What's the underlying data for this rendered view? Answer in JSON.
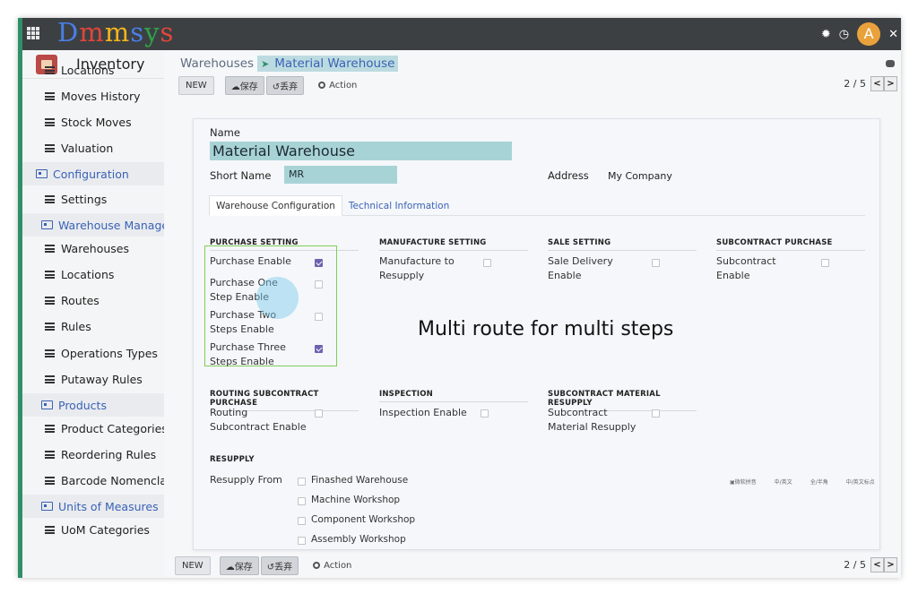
{
  "brand": {
    "letters": [
      {
        "ch": "D",
        "color": "#4a7fe6"
      },
      {
        "ch": "m",
        "color": "#e0463b"
      },
      {
        "ch": "m",
        "color": "#f2b51c"
      },
      {
        "ch": "s",
        "color": "#4a7fe6"
      },
      {
        "ch": "y",
        "color": "#2fa24a"
      },
      {
        "ch": "s",
        "color": "#e0463b"
      }
    ]
  },
  "topbar": {
    "avatar_letter": "A",
    "icons": [
      "bug-icon",
      "clock-icon",
      "expand-icon"
    ]
  },
  "sidebar": {
    "title": "Inventory",
    "entries": [
      {
        "kind": "item",
        "label": "Locations"
      },
      {
        "kind": "item",
        "label": "Moves History"
      },
      {
        "kind": "item",
        "label": "Stock Moves"
      },
      {
        "kind": "item",
        "label": "Valuation"
      },
      {
        "kind": "cat",
        "label": "Configuration",
        "indent": false
      },
      {
        "kind": "item",
        "label": "Settings"
      },
      {
        "kind": "cat",
        "label": "Warehouse Managen",
        "indent": true
      },
      {
        "kind": "item",
        "label": "Warehouses"
      },
      {
        "kind": "item",
        "label": "Locations"
      },
      {
        "kind": "item",
        "label": "Routes"
      },
      {
        "kind": "item",
        "label": "Rules"
      },
      {
        "kind": "item",
        "label": "Operations Types"
      },
      {
        "kind": "item",
        "label": "Putaway Rules"
      },
      {
        "kind": "cat",
        "label": "Products",
        "indent": true
      },
      {
        "kind": "item",
        "label": "Product Categories"
      },
      {
        "kind": "item",
        "label": "Reordering Rules"
      },
      {
        "kind": "item",
        "label": "Barcode Nomenclatu"
      },
      {
        "kind": "cat",
        "label": "Units of Measures",
        "indent": true
      },
      {
        "kind": "item",
        "label": "UoM Categories"
      }
    ]
  },
  "breadcrumb": {
    "parent": "Warehouses",
    "current": "Material Warehouse"
  },
  "toolbar": {
    "new_label": "NEW",
    "save_label": "☁保存",
    "discard_label": "↺丢弃",
    "action_label": "Action"
  },
  "pager": {
    "count": "2 / 5",
    "prev": "<",
    "next": ">"
  },
  "form": {
    "name_label": "Name",
    "name_value": "Material Warehouse",
    "short_name_label": "Short Name",
    "short_name_value": "MR",
    "address_label": "Address",
    "address_value": "My Company",
    "tabs": [
      "Warehouse Configuration",
      "Technical Information"
    ],
    "sections": {
      "purchase": {
        "title": "PURCHASE SETTING",
        "options": [
          {
            "label": "Purchase Enable",
            "checked": true
          },
          {
            "label": "Purchase One Step Enable",
            "checked": false
          },
          {
            "label": "Purchase Two Steps Enable",
            "checked": false
          },
          {
            "label": "Purchase Three Steps Enable",
            "checked": true
          }
        ]
      },
      "manufacture": {
        "title": "MANUFACTURE SETTING",
        "options": [
          {
            "label": "Manufacture to Resupply",
            "checked": false
          }
        ]
      },
      "sale": {
        "title": "SALE SETTING",
        "options": [
          {
            "label": "Sale Delivery Enable",
            "checked": false
          }
        ]
      },
      "subcontract_purchase": {
        "title": "SUBCONTRACT PURCHASE",
        "options": [
          {
            "label": "Subcontract Enable",
            "checked": false
          }
        ]
      },
      "routing": {
        "title": "ROUTING SUBCONTRACT PURCHASE",
        "options": [
          {
            "label": "Routing Subcontract Enable",
            "checked": false
          }
        ]
      },
      "inspection": {
        "title": "INSPECTION",
        "options": [
          {
            "label": "Inspection Enable",
            "checked": false
          }
        ]
      },
      "subcontract_resupply": {
        "title": "SUBCONTRACT MATERIAL RESUPPLY",
        "options": [
          {
            "label": "Subcontract Material Resupply",
            "checked": false
          }
        ]
      },
      "resupply": {
        "title": "RESUPPLY",
        "from_label": "Resupply From",
        "options": [
          {
            "label": "Finashed Warehouse",
            "checked": false
          },
          {
            "label": "Machine Workshop",
            "checked": false
          },
          {
            "label": "Component Workshop",
            "checked": false
          },
          {
            "label": "Assembly Workshop",
            "checked": false
          }
        ]
      }
    }
  },
  "caption": "Multi route for multi steps",
  "ime_toolbar": [
    "▣微软拼音",
    "中/英文",
    "全/半角",
    "中/英文标点"
  ]
}
